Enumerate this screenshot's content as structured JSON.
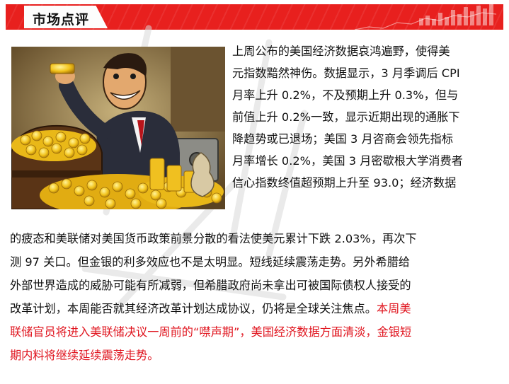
{
  "header": {
    "title": "市场点评"
  },
  "article": {
    "lines_right": [
      "上周公布的美国经济数据哀鸿遍野，使得美",
      "元指数黯然神伤。数据显示，3 月季调后 CPI",
      "月率上升  0.2%，不及预期上升  0.3%，但与",
      "前值上升 0.2%一致，显示近期出现的通胀下",
      "降趋势或已退场；美国 3 月咨商会领先指标",
      "月率增长 0.2%，美国 3 月密歇根大学消费者",
      "信心指数终值超预期上升至 93.0；经济数据"
    ],
    "lines_full": [
      "的疲态和美联储对美国货币政策前景分散的看法使美元累计下跌 2.03%，再次下",
      "测 97 关口。但金银的利多效应也不是太明显。短线延续震荡走势。另外希腊给",
      "外部世界造成的威胁可能有所减弱，但希腊政府尚未拿出可被国际债权人接受的"
    ],
    "line_mixed_black": "改革计划，本周能否就其经济改革计划达成协议，仍将是全球关注焦点。",
    "line_mixed_red": "本周美",
    "lines_red": [
      "联储官员将进入美联储决议一周前的“噤声期”，美国经济数据方面清淡，金银短",
      "期内料将继续延续震荡走势。"
    ]
  },
  "colors": {
    "header_red": "#e8201e",
    "highlight_red": "#e0141e"
  },
  "image": {
    "icon": "cartoon-businessman-with-gold-treasure"
  }
}
